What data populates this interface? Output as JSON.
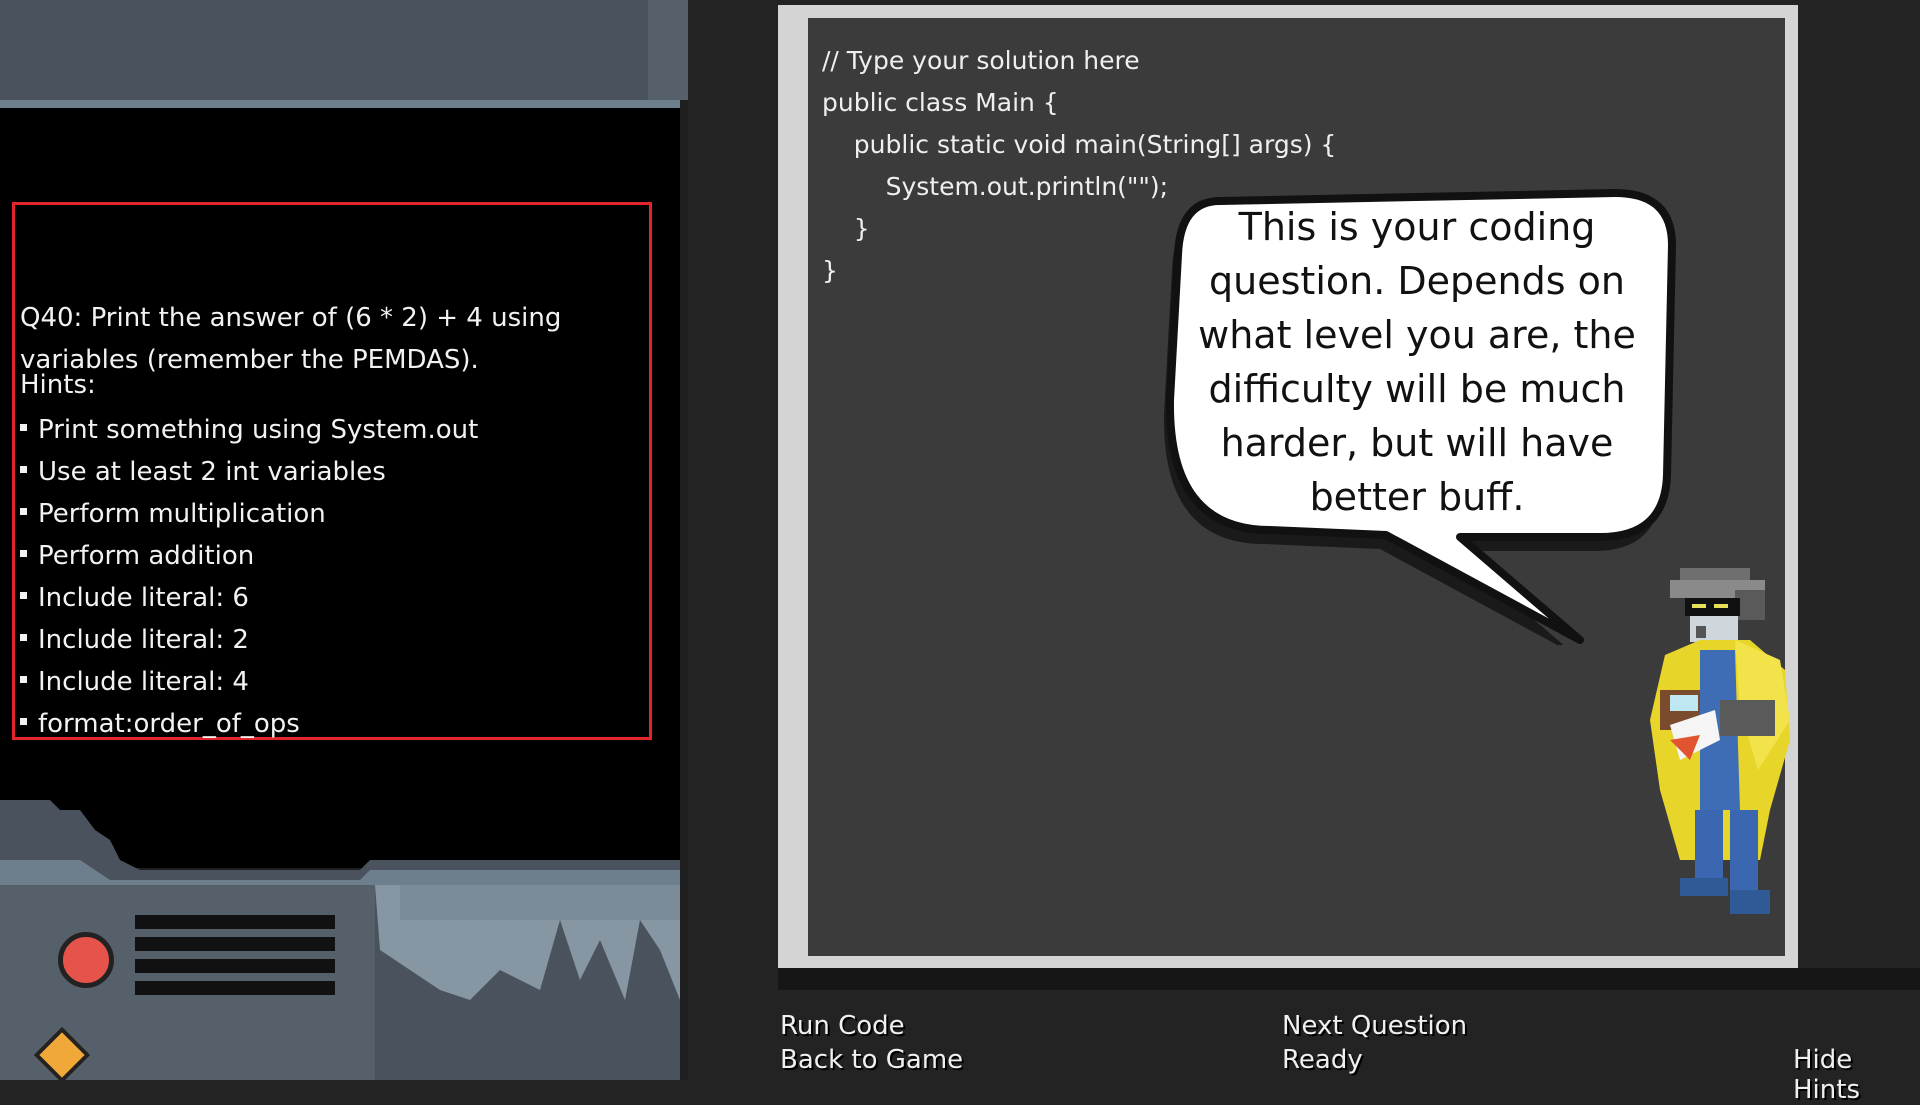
{
  "question": {
    "text": "Q40: Print the answer of (6 * 2) + 4 using variables (remember the PEMDAS).",
    "hints_label": "Hints:",
    "hints": [
      "Print something using System.out",
      "Use at least 2 int variables",
      "Perform multiplication",
      "Perform addition",
      "Include literal: 6",
      "Include literal: 2",
      "Include literal: 4",
      "format:order_of_ops"
    ]
  },
  "editor": {
    "lines": [
      "// Type your solution here",
      "public class Main {",
      "    public static void main(String[] args) {",
      "        System.out.println(\"\");",
      "    }",
      "}"
    ]
  },
  "speech_bubble": {
    "text": "This is your coding question. Depends on what level you are, the difficulty will be much harder, but will have better buff."
  },
  "actions": {
    "run_code": "Run Code",
    "back_to_game": "Back to Game",
    "next_question": "Next Question",
    "status": "Ready",
    "hide_hints": "Hide Hints"
  },
  "colors": {
    "question_border": "#e0262b",
    "editor_bg": "#3b3b3b",
    "editor_frame": "#d4d4d4",
    "machine_gray": "#4a535d",
    "button_red": "#e5534b",
    "light_orange": "#f0a838"
  }
}
